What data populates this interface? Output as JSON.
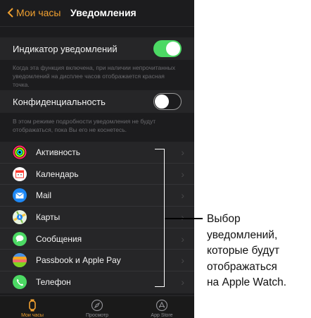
{
  "navbar": {
    "back_label": "Мои часы",
    "title": "Уведомления"
  },
  "settings": {
    "indicator": {
      "label": "Индикатор уведомлений",
      "state": "on",
      "description": "Когда эта функция включена, при наличии непрочитанных уведомлений на дисплее часов отображается красная точка."
    },
    "privacy": {
      "label": "Конфиденциальность",
      "state": "off",
      "description": "В этом режиме подробности уведомления не будут отображаться, пока Вы его не коснетесь."
    }
  },
  "apps": [
    {
      "label": "Активность",
      "icon": "activity-icon"
    },
    {
      "label": "Календарь",
      "icon": "calendar-icon"
    },
    {
      "label": "Mail",
      "icon": "mail-icon"
    },
    {
      "label": "Карты",
      "icon": "maps-icon"
    },
    {
      "label": "Сообщения",
      "icon": "messages-icon"
    },
    {
      "label": "Passbook и Apple Pay",
      "icon": "passbook-icon"
    },
    {
      "label": "Телефон",
      "icon": "phone-icon"
    }
  ],
  "tabbar": {
    "tabs": [
      {
        "label": "Мои часы",
        "icon": "watch-icon",
        "active": true
      },
      {
        "label": "Просмотр",
        "icon": "compass-icon",
        "active": false
      },
      {
        "label": "App Store",
        "icon": "app-store-icon",
        "active": false
      }
    ]
  },
  "callout": {
    "lines": [
      "Выбор",
      "уведомлений,",
      "которые будут",
      "отображаться",
      "на Apple Watch."
    ]
  },
  "colors": {
    "accent": "#f0a030",
    "toggle_on": "#4cd964",
    "background": "#1c1c1e",
    "row_background": "#262628"
  }
}
